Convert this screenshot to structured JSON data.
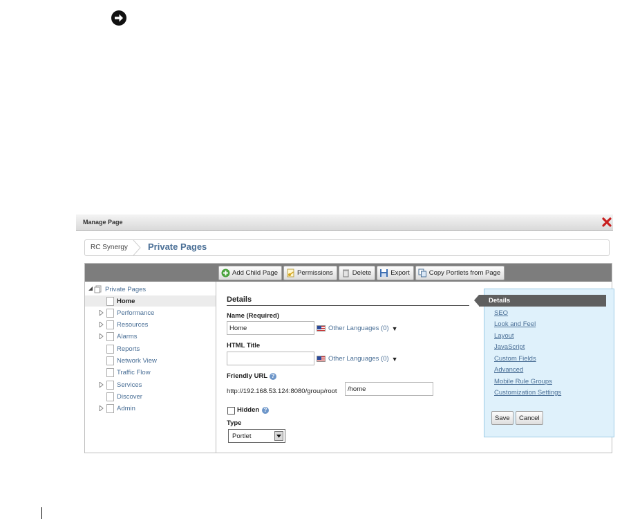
{
  "window": {
    "title": "Manage Page"
  },
  "breadcrumb": {
    "root": "RC Synergy",
    "current": "Private Pages"
  },
  "toolbar": {
    "buttons": [
      {
        "label": "Add Child Page",
        "icon": "add-icon"
      },
      {
        "label": "Permissions",
        "icon": "key-icon"
      },
      {
        "label": "Delete",
        "icon": "trash-icon"
      },
      {
        "label": "Export",
        "icon": "save-icon"
      },
      {
        "label": "Copy Portlets from Page",
        "icon": "copy-icon"
      }
    ]
  },
  "tree": {
    "root": "Private Pages",
    "items": [
      {
        "label": "Home",
        "expandable": false,
        "selected": true
      },
      {
        "label": "Performance",
        "expandable": true
      },
      {
        "label": "Resources",
        "expandable": true
      },
      {
        "label": "Alarms",
        "expandable": true
      },
      {
        "label": "Reports",
        "expandable": false
      },
      {
        "label": "Network View",
        "expandable": false
      },
      {
        "label": "Traffic Flow",
        "expandable": false
      },
      {
        "label": "Services",
        "expandable": true
      },
      {
        "label": "Discover",
        "expandable": false
      },
      {
        "label": "Admin",
        "expandable": true
      }
    ]
  },
  "details": {
    "title": "Details",
    "name_label": "Name (Required)",
    "name_value": "Home",
    "other_languages": "Other Languages (0)",
    "html_title_label": "HTML Title",
    "html_title_value": "",
    "friendly_url_label": "Friendly URL",
    "friendly_url_prefix": "http://192.168.53.124:8080/group/root",
    "friendly_url_value": "/home",
    "hidden_label": "Hidden",
    "hidden_checked": false,
    "type_label": "Type",
    "type_value": "Portlet"
  },
  "nav": {
    "active": "Details",
    "links": [
      "SEO",
      "Look and Feel",
      "Layout",
      "JavaScript",
      "Custom Fields",
      "Advanced",
      "Mobile Rule Groups",
      "Customization Settings"
    ],
    "save_label": "Save",
    "cancel_label": "Cancel"
  },
  "colors": {
    "accent_link": "#4a6f96",
    "toolbar_bg": "#7d7d7d",
    "nav_bg": "#dff1fb",
    "active_tab": "#5f5f5f"
  }
}
